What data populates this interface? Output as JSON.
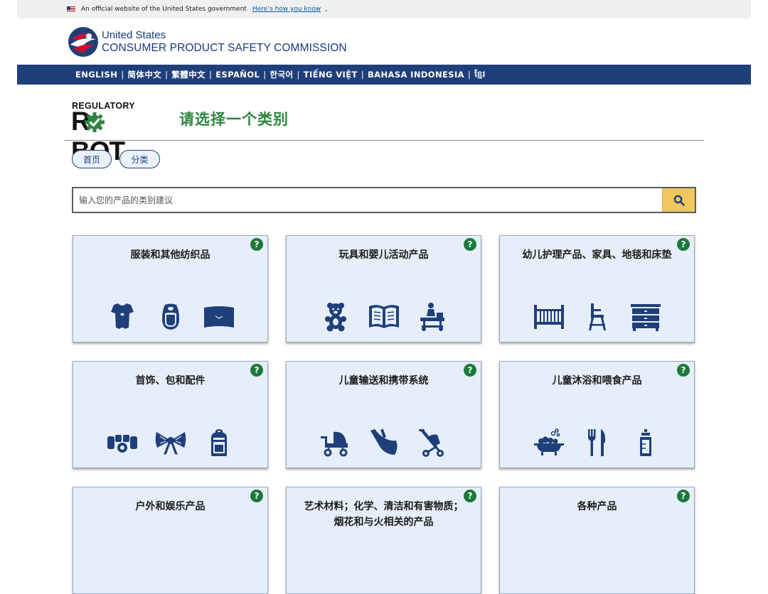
{
  "gov_banner": {
    "text": "An official website of the United States government",
    "link": "Here’s how you know"
  },
  "header": {
    "line1": "United States",
    "line2": "CONSUMER PRODUCT SAFETY COMMISSION"
  },
  "languages": [
    "ENGLISH",
    "简体中文",
    "繁體中文",
    "ESPAÑOL",
    "한국어",
    "TIẾNG VIỆT",
    "BAHASA INDONESIA",
    "ខ្មែរ"
  ],
  "robot": {
    "line1": "REGULATORY",
    "line2": "R   BOT"
  },
  "page_title": "请选择一个类别",
  "breadcrumbs": {
    "home": "首页",
    "category": "分类"
  },
  "search": {
    "placeholder": "输入您的产品的类别建议"
  },
  "help_symbol": "?",
  "categories": [
    {
      "title": "服装和其他纺织品",
      "icons": [
        "onesie-icon",
        "bib-icon",
        "blanket-icon"
      ]
    },
    {
      "title": "玩具和婴儿活动产品",
      "icons": [
        "teddy-bear-icon",
        "book-icon",
        "activity-walker-icon"
      ]
    },
    {
      "title": "幼儿护理产品、家具、地毯和床垫",
      "icons": [
        "crib-icon",
        "high-chair-icon",
        "dresser-icon"
      ]
    },
    {
      "title": "首饰、包和配件",
      "icons": [
        "bracelet-icon",
        "bow-icon",
        "backpack-icon"
      ]
    },
    {
      "title": "儿童输送和携带系统",
      "icons": [
        "stroller-icon",
        "baby-carrier-icon",
        "umbrella-stroller-icon"
      ]
    },
    {
      "title": "儿童沐浴和喂食产品",
      "icons": [
        "bathtub-icon",
        "utensils-icon",
        "baby-bottle-icon"
      ]
    },
    {
      "title": "户外和娱乐产品",
      "icons": []
    },
    {
      "title": "艺术材料；化学、清洁和有害物质；烟花和与火相关的产品",
      "icons": []
    },
    {
      "title": "各种产品",
      "icons": []
    }
  ],
  "colors": {
    "nav_bg": "#1f3f7a",
    "title_green": "#2e8540",
    "icon_navy": "#1f3f7a",
    "card_bg": "#e6eff9",
    "search_btn": "#f2c65e"
  }
}
